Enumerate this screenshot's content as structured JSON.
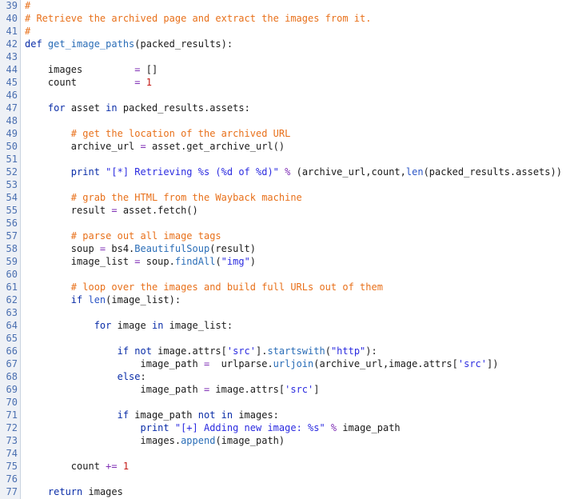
{
  "editor": {
    "lines": [
      {
        "num": "39",
        "tokens": [
          {
            "t": "c",
            "v": "#"
          }
        ]
      },
      {
        "num": "40",
        "tokens": [
          {
            "t": "c",
            "v": "# Retrieve the archived page and extract the images from it."
          }
        ]
      },
      {
        "num": "41",
        "tokens": [
          {
            "t": "c",
            "v": "#"
          }
        ]
      },
      {
        "num": "42",
        "tokens": [
          {
            "t": "k",
            "v": "def "
          },
          {
            "t": "f",
            "v": "get_image_paths"
          },
          {
            "t": "p",
            "v": "(packed_results):"
          }
        ]
      },
      {
        "num": "43",
        "tokens": []
      },
      {
        "num": "44",
        "tokens": [
          {
            "t": "p",
            "v": "    images         "
          },
          {
            "t": "o",
            "v": "= "
          },
          {
            "t": "p",
            "v": "[]"
          }
        ]
      },
      {
        "num": "45",
        "tokens": [
          {
            "t": "p",
            "v": "    count          "
          },
          {
            "t": "o",
            "v": "= "
          },
          {
            "t": "n",
            "v": "1"
          }
        ]
      },
      {
        "num": "46",
        "tokens": []
      },
      {
        "num": "47",
        "tokens": [
          {
            "t": "p",
            "v": "    "
          },
          {
            "t": "k",
            "v": "for"
          },
          {
            "t": "p",
            "v": " asset "
          },
          {
            "t": "k",
            "v": "in"
          },
          {
            "t": "p",
            "v": " packed_results.assets:"
          }
        ]
      },
      {
        "num": "48",
        "tokens": []
      },
      {
        "num": "49",
        "tokens": [
          {
            "t": "p",
            "v": "        "
          },
          {
            "t": "c",
            "v": "# get the location of the archived URL"
          }
        ]
      },
      {
        "num": "50",
        "tokens": [
          {
            "t": "p",
            "v": "        archive_url "
          },
          {
            "t": "o",
            "v": "= "
          },
          {
            "t": "p",
            "v": "asset.get_archive_url()"
          }
        ]
      },
      {
        "num": "51",
        "tokens": []
      },
      {
        "num": "52",
        "tokens": [
          {
            "t": "p",
            "v": "        "
          },
          {
            "t": "k",
            "v": "print "
          },
          {
            "t": "s",
            "v": "\"[*] Retrieving %s (%d of %d)\""
          },
          {
            "t": "o",
            "v": " % "
          },
          {
            "t": "p",
            "v": "(archive_url,count,"
          },
          {
            "t": "b",
            "v": "len"
          },
          {
            "t": "p",
            "v": "(packed_results.assets))"
          }
        ]
      },
      {
        "num": "53",
        "tokens": []
      },
      {
        "num": "54",
        "tokens": [
          {
            "t": "p",
            "v": "        "
          },
          {
            "t": "c",
            "v": "# grab the HTML from the Wayback machine"
          }
        ]
      },
      {
        "num": "55",
        "tokens": [
          {
            "t": "p",
            "v": "        result "
          },
          {
            "t": "o",
            "v": "= "
          },
          {
            "t": "p",
            "v": "asset.fetch()"
          }
        ]
      },
      {
        "num": "56",
        "tokens": []
      },
      {
        "num": "57",
        "tokens": [
          {
            "t": "p",
            "v": "        "
          },
          {
            "t": "c",
            "v": "# parse out all image tags"
          }
        ]
      },
      {
        "num": "58",
        "tokens": [
          {
            "t": "p",
            "v": "        soup "
          },
          {
            "t": "o",
            "v": "= "
          },
          {
            "t": "p",
            "v": "bs4."
          },
          {
            "t": "f",
            "v": "BeautifulSoup"
          },
          {
            "t": "p",
            "v": "(result)"
          }
        ]
      },
      {
        "num": "59",
        "tokens": [
          {
            "t": "p",
            "v": "        image_list "
          },
          {
            "t": "o",
            "v": "= "
          },
          {
            "t": "p",
            "v": "soup."
          },
          {
            "t": "f",
            "v": "findAll"
          },
          {
            "t": "p",
            "v": "("
          },
          {
            "t": "s",
            "v": "\"img\""
          },
          {
            "t": "p",
            "v": ")"
          }
        ]
      },
      {
        "num": "60",
        "tokens": []
      },
      {
        "num": "61",
        "tokens": [
          {
            "t": "p",
            "v": "        "
          },
          {
            "t": "c",
            "v": "# loop over the images and build full URLs out of them"
          }
        ]
      },
      {
        "num": "62",
        "tokens": [
          {
            "t": "p",
            "v": "        "
          },
          {
            "t": "k",
            "v": "if "
          },
          {
            "t": "b",
            "v": "len"
          },
          {
            "t": "p",
            "v": "(image_list):"
          }
        ]
      },
      {
        "num": "63",
        "tokens": []
      },
      {
        "num": "64",
        "tokens": [
          {
            "t": "p",
            "v": "            "
          },
          {
            "t": "k",
            "v": "for"
          },
          {
            "t": "p",
            "v": " image "
          },
          {
            "t": "k",
            "v": "in"
          },
          {
            "t": "p",
            "v": " image_list:"
          }
        ]
      },
      {
        "num": "65",
        "tokens": []
      },
      {
        "num": "66",
        "tokens": [
          {
            "t": "p",
            "v": "                "
          },
          {
            "t": "k",
            "v": "if not "
          },
          {
            "t": "p",
            "v": "image.attrs["
          },
          {
            "t": "s",
            "v": "'src'"
          },
          {
            "t": "p",
            "v": "]."
          },
          {
            "t": "f",
            "v": "startswith"
          },
          {
            "t": "p",
            "v": "("
          },
          {
            "t": "s",
            "v": "\"http\""
          },
          {
            "t": "p",
            "v": "):"
          }
        ]
      },
      {
        "num": "67",
        "tokens": [
          {
            "t": "p",
            "v": "                    image_path "
          },
          {
            "t": "o",
            "v": "= "
          },
          {
            "t": "p",
            "v": " urlparse."
          },
          {
            "t": "f",
            "v": "urljoin"
          },
          {
            "t": "p",
            "v": "(archive_url,image.attrs["
          },
          {
            "t": "s",
            "v": "'src'"
          },
          {
            "t": "p",
            "v": "])"
          }
        ]
      },
      {
        "num": "68",
        "tokens": [
          {
            "t": "p",
            "v": "                "
          },
          {
            "t": "k",
            "v": "else"
          },
          {
            "t": "p",
            "v": ":"
          }
        ]
      },
      {
        "num": "69",
        "tokens": [
          {
            "t": "p",
            "v": "                    image_path "
          },
          {
            "t": "o",
            "v": "= "
          },
          {
            "t": "p",
            "v": "image.attrs["
          },
          {
            "t": "s",
            "v": "'src'"
          },
          {
            "t": "p",
            "v": "]"
          }
        ]
      },
      {
        "num": "70",
        "tokens": []
      },
      {
        "num": "71",
        "tokens": [
          {
            "t": "p",
            "v": "                "
          },
          {
            "t": "k",
            "v": "if"
          },
          {
            "t": "p",
            "v": " image_path "
          },
          {
            "t": "k",
            "v": "not in"
          },
          {
            "t": "p",
            "v": " images:"
          }
        ]
      },
      {
        "num": "72",
        "tokens": [
          {
            "t": "p",
            "v": "                    "
          },
          {
            "t": "k",
            "v": "print "
          },
          {
            "t": "s",
            "v": "\"[+] Adding new image: %s\""
          },
          {
            "t": "o",
            "v": " % "
          },
          {
            "t": "p",
            "v": "image_path"
          }
        ]
      },
      {
        "num": "73",
        "tokens": [
          {
            "t": "p",
            "v": "                    images."
          },
          {
            "t": "f",
            "v": "append"
          },
          {
            "t": "p",
            "v": "(image_path)"
          }
        ]
      },
      {
        "num": "74",
        "tokens": []
      },
      {
        "num": "75",
        "tokens": [
          {
            "t": "p",
            "v": "        count "
          },
          {
            "t": "o",
            "v": "+= "
          },
          {
            "t": "n",
            "v": "1"
          }
        ]
      },
      {
        "num": "76",
        "tokens": []
      },
      {
        "num": "77",
        "tokens": [
          {
            "t": "p",
            "v": "    "
          },
          {
            "t": "k",
            "v": "return"
          },
          {
            "t": "p",
            "v": " images"
          }
        ]
      }
    ]
  }
}
